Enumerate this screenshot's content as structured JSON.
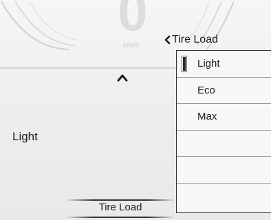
{
  "speedometer": {
    "value": "0",
    "unit": "km/h"
  },
  "current_setting": {
    "value": "Light"
  },
  "bottom_tab": {
    "label": "Tire Load"
  },
  "menu": {
    "title": "Tire Load",
    "selected_index": 0,
    "items": [
      {
        "label": "Light",
        "selected": true
      },
      {
        "label": "Eco",
        "selected": false
      },
      {
        "label": "Max",
        "selected": false
      },
      {
        "label": "",
        "selected": false
      },
      {
        "label": "",
        "selected": false
      },
      {
        "label": "",
        "selected": false
      }
    ]
  },
  "icons": {
    "back": "chevron-left-icon",
    "scroll_up": "caret-up-icon",
    "selection": "radio-indicator-icon"
  },
  "colors": {
    "background": "#ececec",
    "text": "#1c1c1c",
    "gauge_faded": "#dddddd"
  }
}
